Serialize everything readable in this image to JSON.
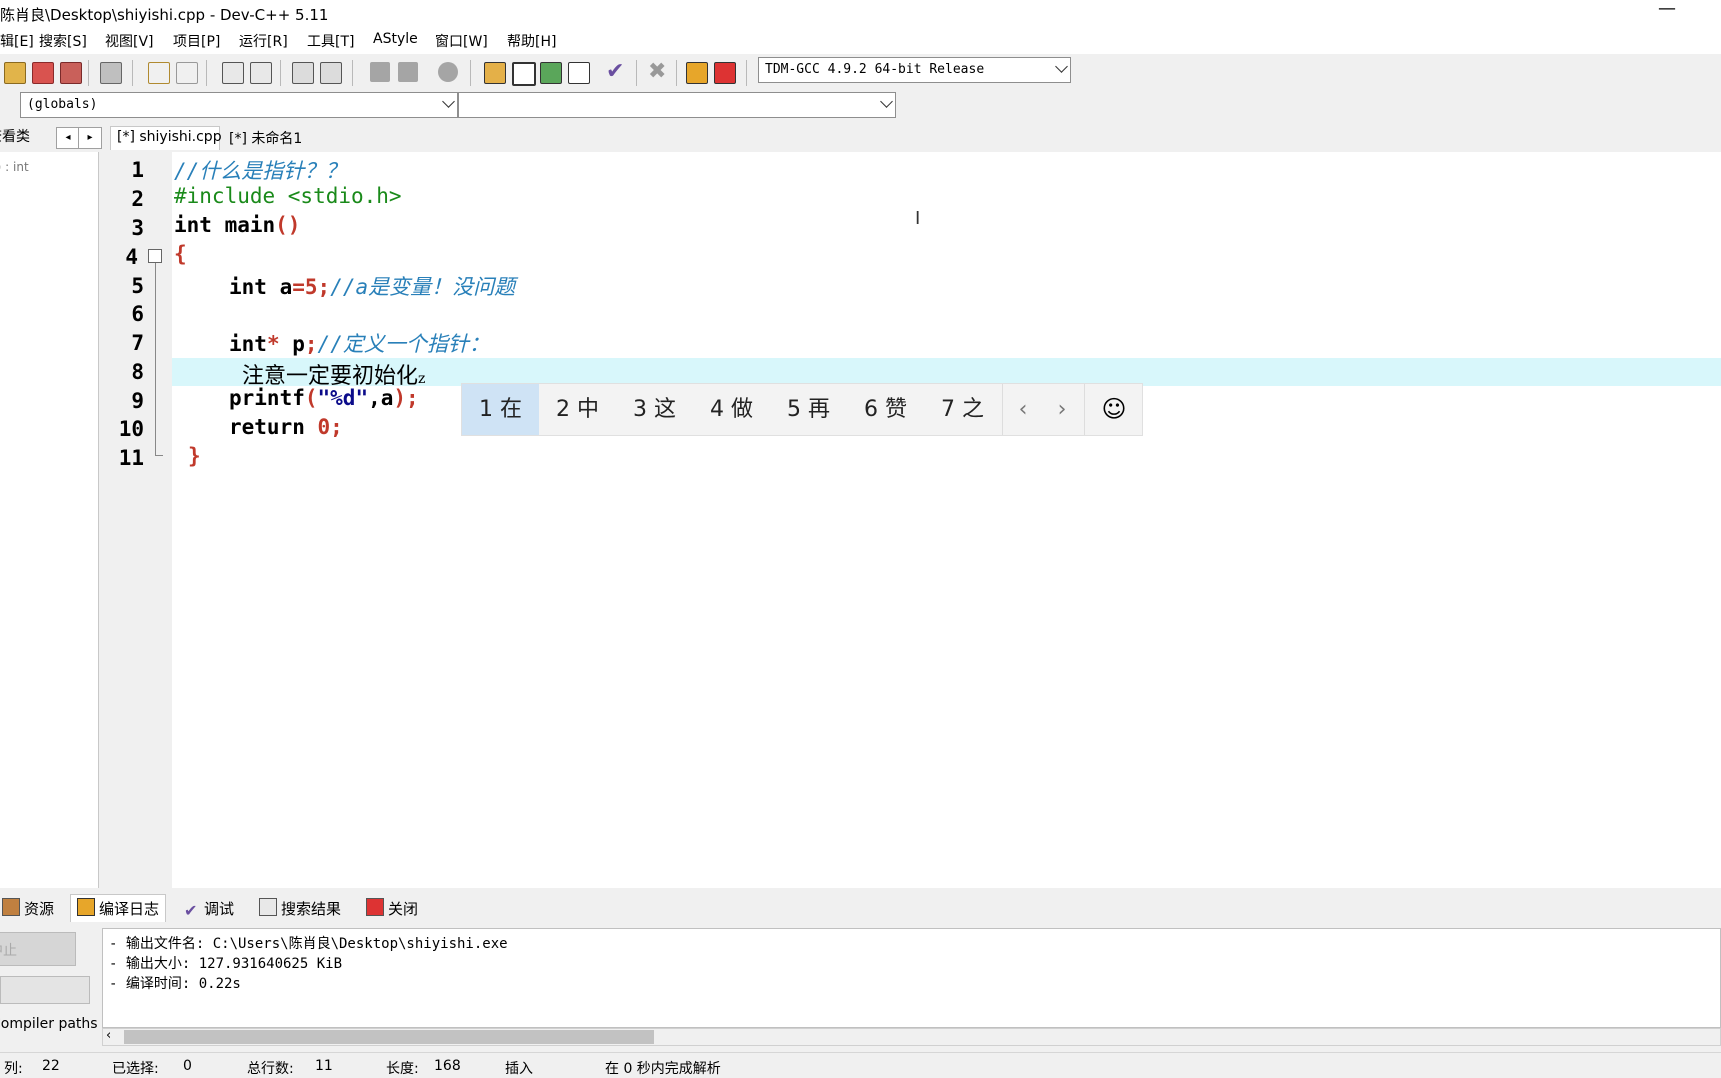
{
  "window": {
    "title": "陈肖良\\Desktop\\shiyishi.cpp - Dev-C++ 5.11",
    "minimize_glyph": "—"
  },
  "menu": [
    "编辑[E]",
    "搜索[S]",
    "视图[V]",
    "项目[P]",
    "运行[R]",
    "工具[T]",
    "AStyle",
    "窗口[W]",
    "帮助[H]"
  ],
  "toolbar": {
    "compiler": "TDM-GCC 4.9.2 64-bit Release",
    "scope": "(globals)",
    "members": ""
  },
  "left_panel": {
    "tab": "查看类",
    "class_item": "() : int",
    "arrow_left": "◂",
    "arrow_right": "▸",
    "stop_button": "中止",
    "compiler_paths_label": "Compiler paths"
  },
  "editor_tabs": [
    "[*] shiyishi.cpp",
    "[*] 未命名1"
  ],
  "code": {
    "line_numbers": [
      "1",
      "2",
      "3",
      "4",
      "5",
      "6",
      "7",
      "8",
      "9",
      "10",
      "11"
    ],
    "line1_comment": "//什么是指针？？",
    "line2_include": "#include <stdio.h>",
    "line3_kw": "int",
    "line3_rest": " main",
    "line3_paren": "()",
    "line4_brace": "{",
    "line5_kw": "int",
    "line5_var": " a",
    "line5_eq": "=",
    "line5_num": "5",
    "line5_semi": ";",
    "line5_comment": "//a是变量！没问题",
    "line7_kw": "int",
    "line7_star": "*",
    "line7_var": " p",
    "line7_semi": ";",
    "line7_comment": "//定义一个指针：",
    "line8_composition": "注意一定要初始化",
    "line8_pending": "z",
    "line9_fn": "printf",
    "line9_lp": "(",
    "line9_str": "\"%d\"",
    "line9_comma": ",a",
    "line9_rp": ");",
    "line10_kw": "return",
    "line10_num": "0",
    "line10_semi": ";",
    "line11_brace": "}"
  },
  "ime": {
    "candidates": [
      "1 在",
      "2 中",
      "3 这",
      "4 做",
      "5 再",
      "6 赞",
      "7 之"
    ],
    "selected_index": 0,
    "prev": "‹",
    "next": "›",
    "emoji": "☺"
  },
  "bottom_tabs": [
    "资源",
    "编译日志",
    "调试",
    "搜索结果",
    "关闭"
  ],
  "log_lines": [
    "- 输出文件名: C:\\Users\\陈肖良\\Desktop\\shiyishi.exe",
    "- 输出大小: 127.931640625 KiB",
    "- 编译时间: 0.22s"
  ],
  "status": {
    "col_label": "列:",
    "col_value": "22",
    "sel_label": "已选择:",
    "sel_value": "0",
    "lines_label": "总行数:",
    "lines_value": "11",
    "len_label": "长度:",
    "len_value": "168",
    "mode": "插入",
    "parse": "在 0 秒内完成解析"
  },
  "colors": {
    "comment": "#2980b9",
    "preprocessor": "#1a8a1a",
    "number": "#c0392b",
    "current_line": "#d8f7fb",
    "ime_selected": "#cfe3f5"
  }
}
